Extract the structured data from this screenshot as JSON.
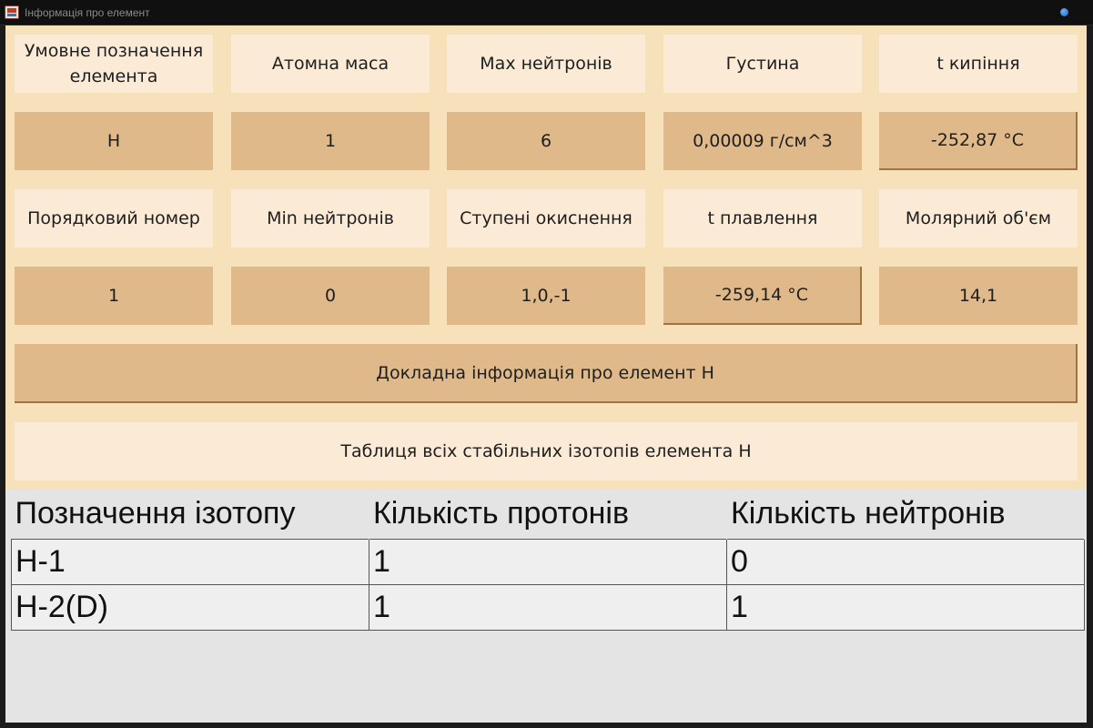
{
  "window": {
    "title": "Інформація про елемент"
  },
  "grid": {
    "row1_labels": [
      "Умовне позначення елемента",
      "Атомна маса",
      "Max нейтронів",
      "Густина",
      "t кипіння"
    ],
    "row1_values": [
      "H",
      "1",
      "6",
      "0,00009 г/см^3",
      "-252,87 °C"
    ],
    "row2_labels": [
      "Порядковий номер",
      "Min нейтронів",
      "Ступені окиснення",
      "t плавлення",
      "Молярний об'єм"
    ],
    "row2_values": [
      "1",
      "0",
      "1,0,-1",
      "-259,14 °C",
      "14,1"
    ]
  },
  "details_button_label": "Докладна інформація про елемент H",
  "isotopes_caption": "Таблиця всіх стабільних ізотопів елемента H",
  "isotopes_table": {
    "headers": [
      "Позначення ізотопу",
      "Кількість протонів",
      "Кількість нейтронів"
    ],
    "rows": [
      [
        "H-1",
        "1",
        "0"
      ],
      [
        "H-2(D)",
        "1",
        "1"
      ]
    ]
  },
  "colors": {
    "label_bg": "#fbebd6",
    "value_bg": "#e0b98b",
    "panel_bg": "#f6e1bb",
    "table_bg": "#e4e4e4"
  }
}
